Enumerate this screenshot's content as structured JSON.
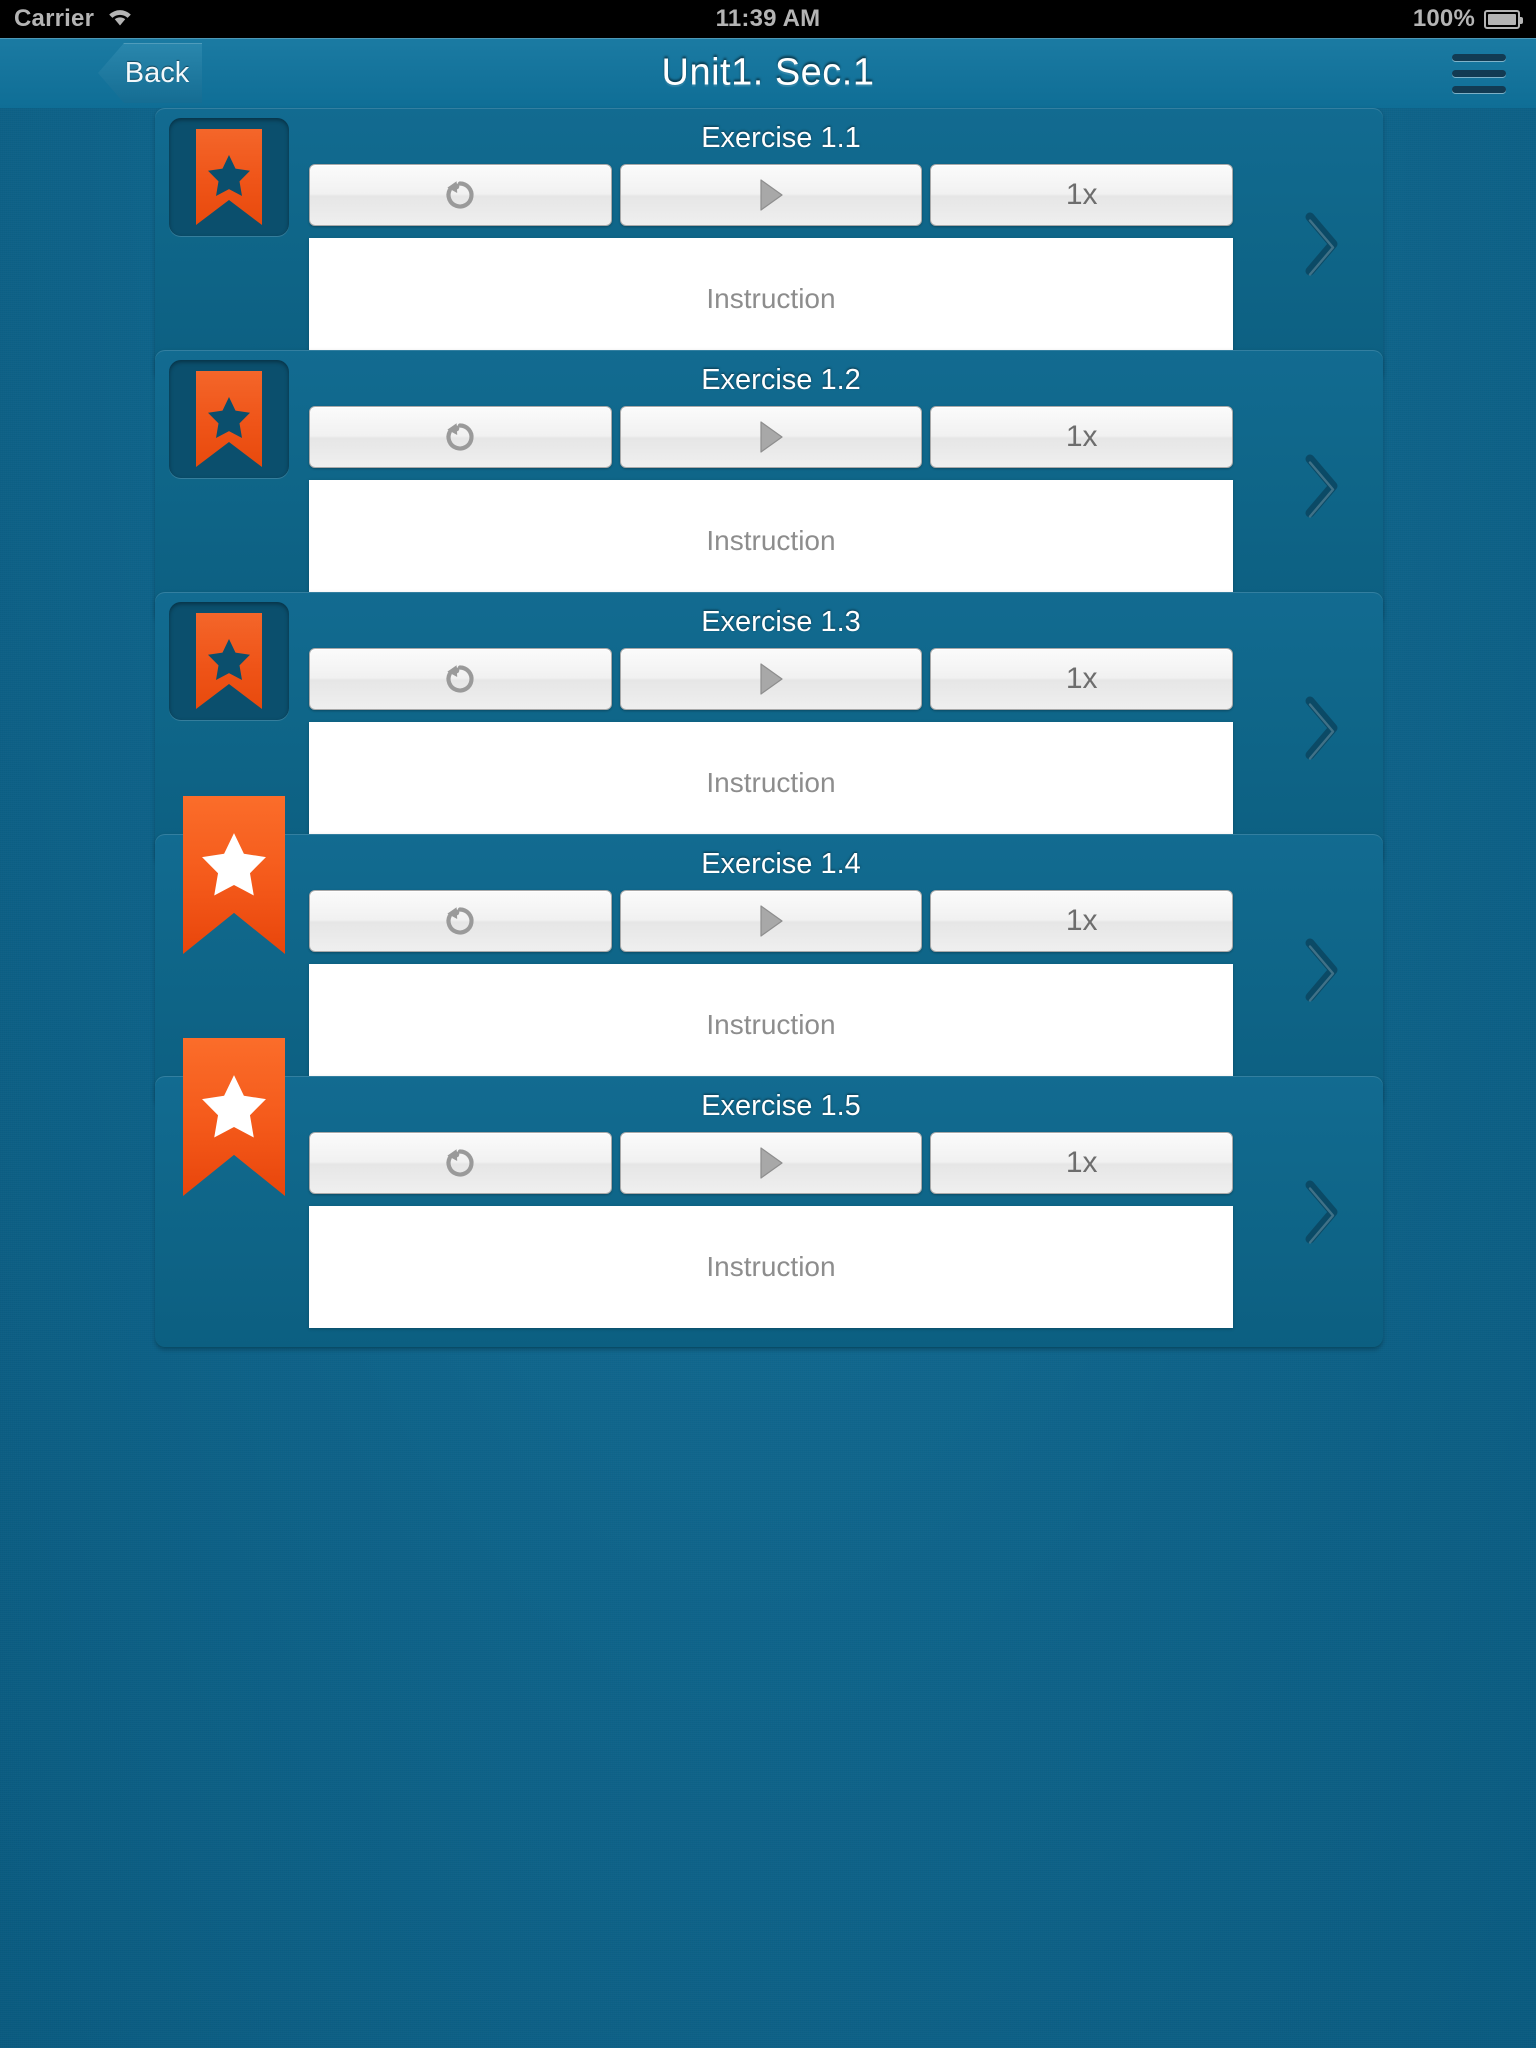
{
  "status_bar": {
    "carrier": "Carrier",
    "wifi_icon": "wifi-icon",
    "time": "11:39 AM",
    "battery_percent": "100%",
    "battery_icon": "battery-full-icon"
  },
  "nav_bar": {
    "back_label": "Back",
    "title": "Unit1. Sec.1",
    "menu_icon": "hamburger-menu-icon"
  },
  "theme": {
    "background_blue": "#0e6389",
    "card_blue": "#0f6689",
    "nav_blue": "#15749c",
    "ribbon_orange": "#ef5418",
    "star_dark": "#0b4f6d",
    "star_white": "#ffffff",
    "button_face": "#f0f0f0",
    "instruction_text": "#8d8d8d"
  },
  "exercises": [
    {
      "title": "Exercise 1.1",
      "bookmarked": false,
      "star_icon": "star-icon",
      "replay_icon": "replay-icon",
      "play_icon": "play-icon",
      "speed_label": "1x",
      "instruction_label": "Instruction",
      "chevron_icon": "chevron-right-icon"
    },
    {
      "title": "Exercise 1.2",
      "bookmarked": false,
      "star_icon": "star-icon",
      "replay_icon": "replay-icon",
      "play_icon": "play-icon",
      "speed_label": "1x",
      "instruction_label": "Instruction",
      "chevron_icon": "chevron-right-icon"
    },
    {
      "title": "Exercise 1.3",
      "bookmarked": false,
      "star_icon": "star-icon",
      "replay_icon": "replay-icon",
      "play_icon": "play-icon",
      "speed_label": "1x",
      "instruction_label": "Instruction",
      "chevron_icon": "chevron-right-icon"
    },
    {
      "title": "Exercise 1.4",
      "bookmarked": true,
      "star_icon": "star-icon",
      "replay_icon": "replay-icon",
      "play_icon": "play-icon",
      "speed_label": "1x",
      "instruction_label": "Instruction",
      "chevron_icon": "chevron-right-icon"
    },
    {
      "title": "Exercise 1.5",
      "bookmarked": true,
      "star_icon": "star-icon",
      "replay_icon": "replay-icon",
      "play_icon": "play-icon",
      "speed_label": "1x",
      "instruction_label": "Instruction",
      "chevron_icon": "chevron-right-icon"
    }
  ]
}
